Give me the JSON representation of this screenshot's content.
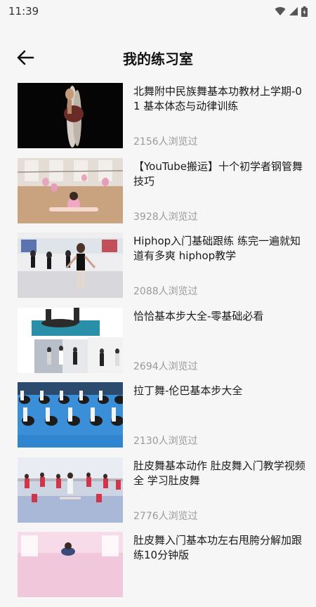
{
  "status": {
    "time": "11:39"
  },
  "header": {
    "title": "我的练习室"
  },
  "videos": [
    {
      "title": "北舞附中民族舞基本功教材上学期-01 基本体态与动律训练",
      "views": "2156人浏览过"
    },
    {
      "title": "【YouTube搬运】十个初学者钢管舞技巧",
      "views": "3928人浏览过"
    },
    {
      "title": "Hiphop入门基础跟练 练完一遍就知道有多爽 hiphop教学",
      "views": "2088人浏览过"
    },
    {
      "title": "恰恰基本步大全-零基础必看",
      "views": "2694人浏览过"
    },
    {
      "title": "拉丁舞-伦巴基本步大全",
      "views": "2130人浏览过"
    },
    {
      "title": "肚皮舞基本动作 肚皮舞入门教学视频全 学习肚皮舞",
      "views": "2776人浏览过"
    },
    {
      "title": "肚皮舞入门基本功左右甩胯分解加跟练10分钟版",
      "views": ""
    }
  ]
}
